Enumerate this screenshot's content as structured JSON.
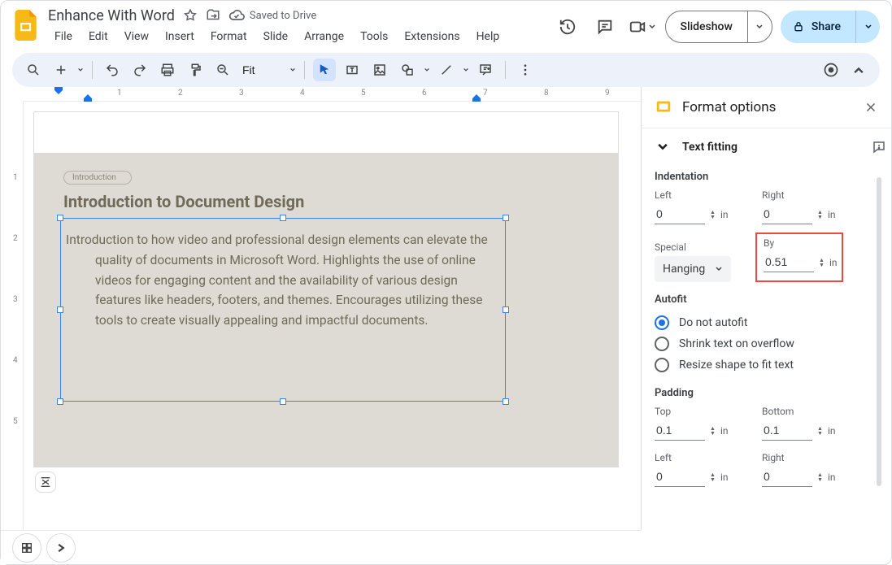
{
  "header": {
    "doc_name": "Enhance With Word",
    "save_state": "Saved to Drive",
    "menus": [
      "File",
      "Edit",
      "View",
      "Insert",
      "Format",
      "Slide",
      "Arrange",
      "Tools",
      "Extensions",
      "Help"
    ],
    "slideshow_label": "Slideshow",
    "share_label": "Share"
  },
  "toolbar": {
    "zoom": "Fit"
  },
  "slide": {
    "chip": "Introduction",
    "title": "Introduction to Document Design",
    "body": "Introduction to how video and professional design elements can elevate the quality of documents in Microsoft Word. Highlights the use of online videos for engaging content and the availability of various design features like headers, footers, and themes. Encourages utilizing these tools to create visually appealing and impactful documents."
  },
  "sidebar": {
    "title": "Format options",
    "section_text_fitting": "Text fitting",
    "indentation": {
      "heading": "Indentation",
      "left_label": "Left",
      "left_value": "0",
      "right_label": "Right",
      "right_value": "0",
      "special_label": "Special",
      "special_value": "Hanging",
      "by_label": "By",
      "by_value": "0.51",
      "unit": "in"
    },
    "autofit": {
      "heading": "Autofit",
      "options": [
        "Do not autofit",
        "Shrink text on overflow",
        "Resize shape to fit text"
      ],
      "selected": 0
    },
    "padding": {
      "heading": "Padding",
      "top_label": "Top",
      "top_value": "0.1",
      "bottom_label": "Bottom",
      "bottom_value": "0.1",
      "left_label": "Left",
      "left_value": "0",
      "right_label": "Right",
      "right_value": "0",
      "unit": "in"
    }
  },
  "ruler_numbers_h": [
    "1",
    "2",
    "3",
    "4",
    "5",
    "6",
    "7",
    "8",
    "9"
  ],
  "ruler_numbers_v": [
    "1",
    "2",
    "3",
    "4",
    "5"
  ]
}
